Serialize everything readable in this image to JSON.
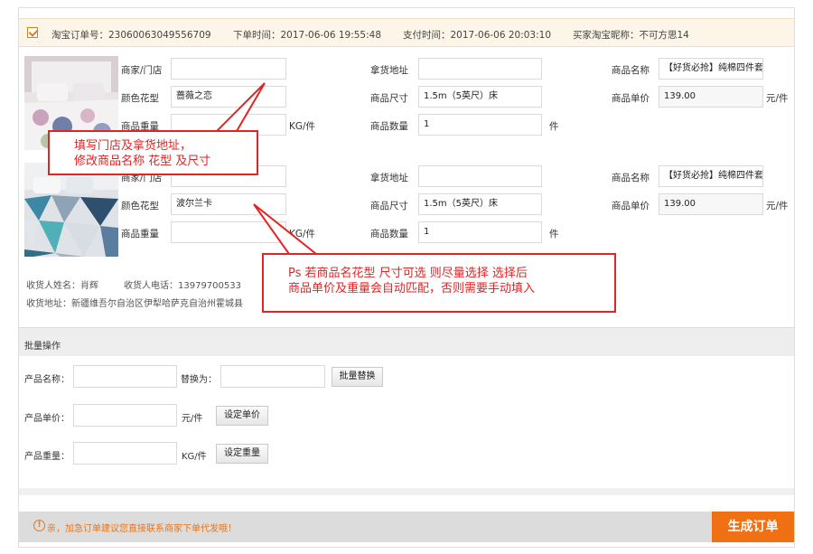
{
  "order": {
    "order_no": "淘宝订单号：23060063049556709",
    "order_time": "下单时间：2017-06-06 19:55:48",
    "pay_time": "支付时间：2017-06-06 20:03:10",
    "buyer": "买家淘宝昵称：不可方思14"
  },
  "labels": {
    "store": "商家/门店",
    "pickup": "拿货地址",
    "name": "商品名称",
    "pattern": "颜色花型",
    "size": "商品尺寸",
    "price": "商品单价",
    "weight": "商品重量",
    "qty": "商品数量",
    "weight_unit": "KG/件",
    "qty_unit": "件",
    "price_unit": "元/件"
  },
  "items": [
    {
      "store": "",
      "pickup": "",
      "name": "【好货必抢】纯棉四件套",
      "pattern": "蔷薇之恋",
      "size": "1.5m（5英尺）床",
      "price": "139.00",
      "weight": "",
      "qty": "1"
    },
    {
      "store": "",
      "pickup": "",
      "name": "【好货必抢】纯棉四件套",
      "pattern": "波尔兰卡",
      "size": "1.5m（5英尺）床",
      "price": "139.00",
      "weight": "",
      "qty": "1"
    }
  ],
  "receiver": {
    "name": "收货人姓名：肖辉",
    "phone": "收货人电话：13979700533",
    "address": "收货地址：新疆维吾尔自治区伊犁哈萨克自治州霍城县"
  },
  "bulk": {
    "title": "批量操作",
    "product_name_label": "产品名称：",
    "replace_label": "替换为：",
    "replace_btn": "批量替换",
    "price_label": "产品单价：",
    "price_unit": "元/件",
    "set_price_btn": "设定单价",
    "weight_label": "产品重量：",
    "weight_unit": "KG/件",
    "set_weight_btn": "设定重量"
  },
  "footer": {
    "notice": "亲，加急订单建议您直接联系商家下单代发哦！",
    "submit": "生成订单"
  },
  "callouts": {
    "first": [
      "填写门店及拿货地址，",
      "修改商品名称 花型 及尺寸"
    ],
    "second": [
      "Ps 若商品名花型 尺寸可选 则尽量选择 选择后",
      "商品单价及重量会自动匹配，否则需要手动填入"
    ]
  },
  "colors": {
    "accent": "#f07014",
    "callout": "#e32424",
    "header_bg": "#fdf6e8"
  }
}
